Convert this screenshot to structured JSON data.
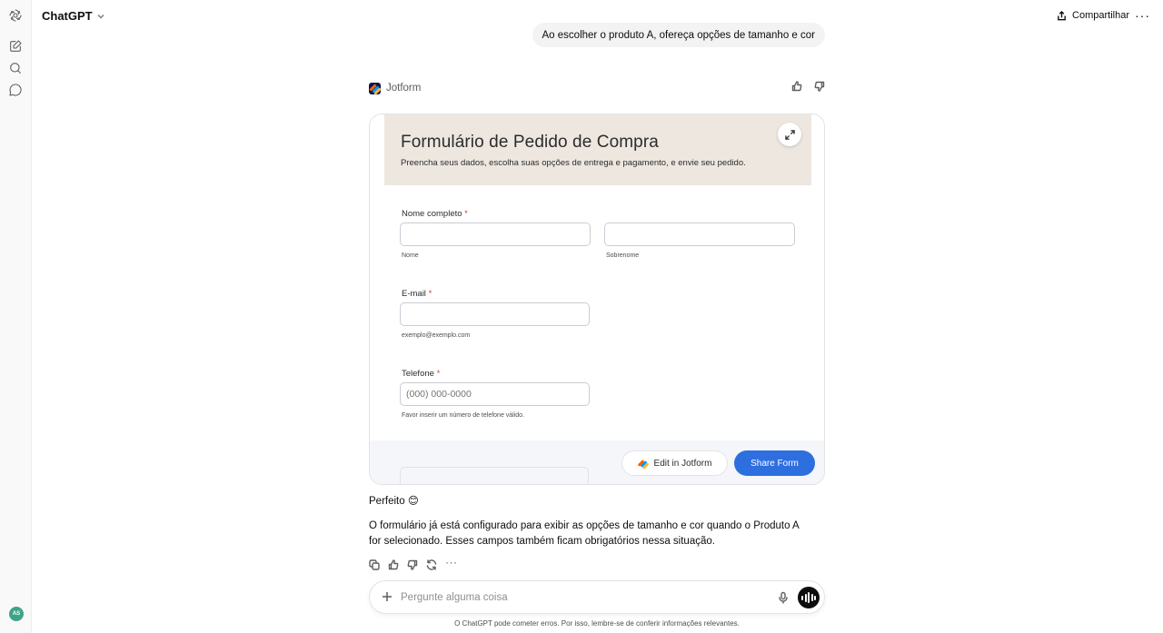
{
  "header": {
    "model_name": "ChatGPT",
    "share_label": "Compartilhar"
  },
  "sidebar": {
    "avatar_initials": "AS",
    "icons": [
      "openai-logo-icon",
      "new-chat-icon",
      "search-icon",
      "chat-bubble-icon"
    ]
  },
  "conversation": {
    "user_message": "Ao escolher o produto A, ofereça opções de tamanho e cor",
    "tool_name": "Jotform",
    "form": {
      "title": "Formulário de Pedido de Compra",
      "subtitle": "Preencha seus dados, escolha suas opções de entrega e pagamento, e envie seu pedido.",
      "name_label": "Nome completo",
      "required_mark": "*",
      "first_name_hint": "Nome",
      "last_name_hint": "Sobrenome",
      "email_label": "E-mail",
      "email_hint": "exemplo@exemplo.com",
      "phone_label": "Telefone",
      "phone_placeholder": "(000) 000-0000",
      "phone_hint": "Favor inserir um número de telefone válido.",
      "edit_button": "Edit in Jotform",
      "share_button": "Share Form"
    },
    "reply_line_1": "Perfeito 😊",
    "reply_line_2": "O formulário já está configurado para exibir as opções de tamanho e cor quando o Produto A for selecionado. Esses campos também ficam obrigatórios nessa situação."
  },
  "composer": {
    "placeholder": "Pergunte alguma coisa",
    "disclaimer": "O ChatGPT pode cometer erros. Por isso, lembre-se de conferir informações relevantes."
  },
  "colors": {
    "share_form_button": "#2e6fe0",
    "form_header_bg": "#ede7e0",
    "required": "#e53935",
    "avatar": "#3fa38a"
  }
}
